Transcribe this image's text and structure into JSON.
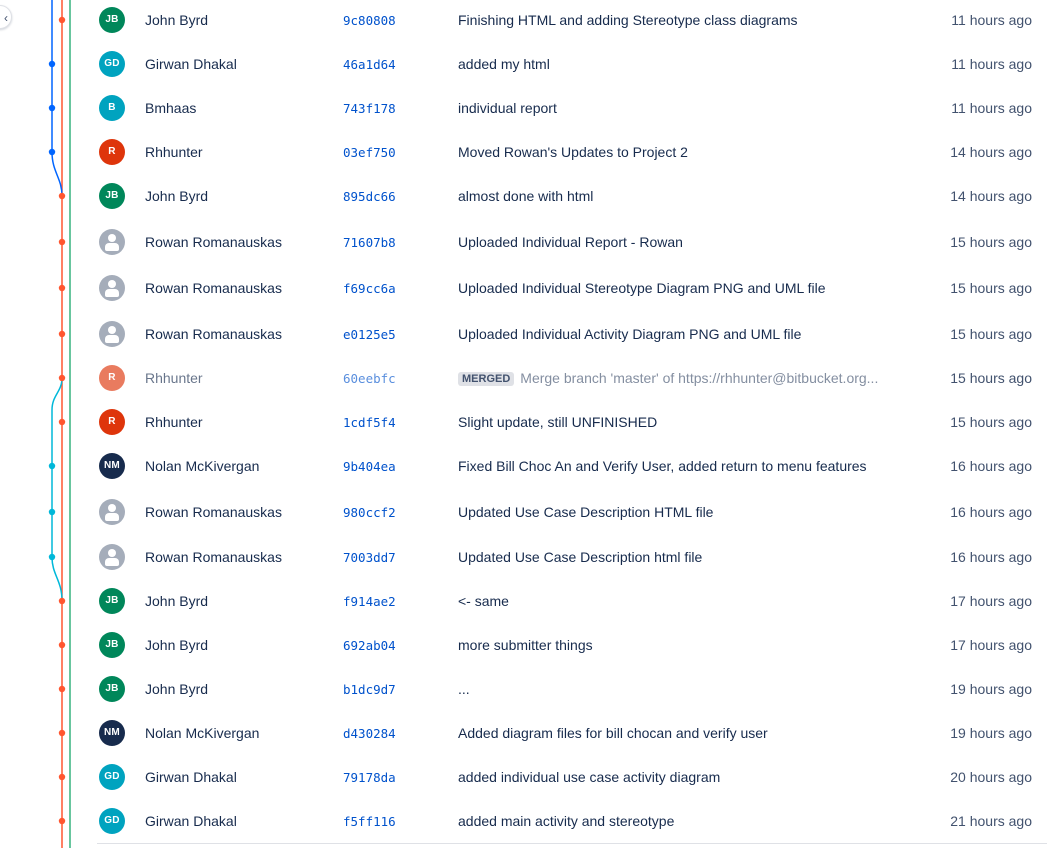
{
  "colors": {
    "branch_orange": "#ff5630",
    "branch_blue": "#0065ff",
    "branch_teal": "#00b8d9",
    "branch_green": "#36b37e",
    "hash_link": "#0052cc"
  },
  "expander_icon": "chevron-left-icon",
  "merged_badge": "MERGED",
  "commits": [
    {
      "author": "John Byrd",
      "initials": "JB",
      "avatar_color": "#00875a",
      "hash": "9c80808",
      "message": "Finishing HTML and adding Stereotype class diagrams",
      "date": "11 hours ago"
    },
    {
      "author": "Girwan Dhakal",
      "initials": "GD",
      "avatar_color": "#00a3bf",
      "hash": "46a1d64",
      "message": "added my html",
      "date": "11 hours ago"
    },
    {
      "author": "Bmhaas",
      "initials": "B",
      "avatar_color": "#00a3bf",
      "hash": "743f178",
      "message": "individual report",
      "date": "11 hours ago"
    },
    {
      "author": "Rhhunter",
      "initials": "R",
      "avatar_color": "#de350b",
      "hash": "03ef750",
      "message": "Moved Rowan's Updates to Project 2",
      "date": "14 hours ago"
    },
    {
      "author": "John Byrd",
      "initials": "JB",
      "avatar_color": "#00875a",
      "hash": "895dc66",
      "message": "almost done with html",
      "date": "14 hours ago"
    },
    {
      "author": "Rowan Romanauskas",
      "initials": "",
      "avatar_color": "",
      "hash": "71607b8",
      "message": "Uploaded Individual Report - Rowan",
      "date": "15 hours ago"
    },
    {
      "author": "Rowan Romanauskas",
      "initials": "",
      "avatar_color": "",
      "hash": "f69cc6a",
      "message": "Uploaded Individual Stereotype Diagram PNG and UML file",
      "date": "15 hours ago"
    },
    {
      "author": "Rowan Romanauskas",
      "initials": "",
      "avatar_color": "",
      "hash": "e0125e5",
      "message": "Uploaded Individual Activity Diagram PNG and UML file",
      "date": "15 hours ago"
    },
    {
      "author": "Rhhunter",
      "initials": "R",
      "avatar_color": "#de350b",
      "hash": "60eebfc",
      "message": "Merge branch 'master' of https://rhhunter@bitbucket.org...",
      "date": "15 hours ago",
      "merged": true
    },
    {
      "author": "Rhhunter",
      "initials": "R",
      "avatar_color": "#de350b",
      "hash": "1cdf5f4",
      "message": "Slight update, still UNFINISHED",
      "date": "15 hours ago"
    },
    {
      "author": "Nolan McKivergan",
      "initials": "NM",
      "avatar_color": "#172b4d",
      "hash": "9b404ea",
      "message": "Fixed Bill Choc An and Verify User, added return to menu features",
      "date": "16 hours ago"
    },
    {
      "author": "Rowan Romanauskas",
      "initials": "",
      "avatar_color": "",
      "hash": "980ccf2",
      "message": "Updated Use Case Description HTML file",
      "date": "16 hours ago"
    },
    {
      "author": "Rowan Romanauskas",
      "initials": "",
      "avatar_color": "",
      "hash": "7003dd7",
      "message": "Updated Use Case Description html file",
      "date": "16 hours ago"
    },
    {
      "author": "John Byrd",
      "initials": "JB",
      "avatar_color": "#00875a",
      "hash": "f914ae2",
      "message": "<- same",
      "date": "17 hours ago"
    },
    {
      "author": "John Byrd",
      "initials": "JB",
      "avatar_color": "#00875a",
      "hash": "692ab04",
      "message": "more submitter things",
      "date": "17 hours ago"
    },
    {
      "author": "John Byrd",
      "initials": "JB",
      "avatar_color": "#00875a",
      "hash": "b1dc9d7",
      "message": "...",
      "date": "19 hours ago"
    },
    {
      "author": "Nolan McKivergan",
      "initials": "NM",
      "avatar_color": "#172b4d",
      "hash": "d430284",
      "message": "Added diagram files for bill chocan and verify user",
      "date": "19 hours ago"
    },
    {
      "author": "Girwan Dhakal",
      "initials": "GD",
      "avatar_color": "#00a3bf",
      "hash": "79178da",
      "message": "added individual use case activity diagram",
      "date": "20 hours ago"
    },
    {
      "author": "Girwan Dhakal",
      "initials": "GD",
      "avatar_color": "#00a3bf",
      "hash": "f5ff116",
      "message": "added main activity and stereotype",
      "date": "21 hours ago"
    }
  ]
}
